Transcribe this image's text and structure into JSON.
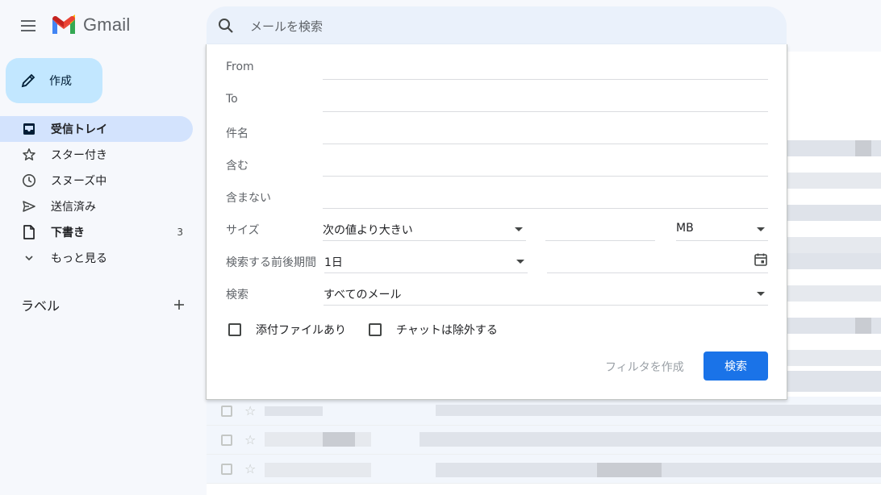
{
  "header": {
    "app_name": "Gmail",
    "search_placeholder": "メールを検索"
  },
  "compose": {
    "label": "作成"
  },
  "sidebar": {
    "items": [
      {
        "label": "受信トレイ",
        "icon": "inbox-icon",
        "active": true,
        "count": ""
      },
      {
        "label": "スター付き",
        "icon": "star-icon",
        "active": false,
        "count": ""
      },
      {
        "label": "スヌーズ中",
        "icon": "clock-icon",
        "active": false,
        "count": ""
      },
      {
        "label": "送信済み",
        "icon": "send-icon",
        "active": false,
        "count": ""
      },
      {
        "label": "下書き",
        "icon": "draft-icon",
        "active": false,
        "count": "3"
      },
      {
        "label": "もっと見る",
        "icon": "chevron-down-icon",
        "active": false,
        "count": ""
      }
    ],
    "labels_title": "ラベル"
  },
  "search_panel": {
    "from_label": "From",
    "to_label": "To",
    "subject_label": "件名",
    "has_words_label": "含む",
    "no_words_label": "含まない",
    "size_label": "サイズ",
    "size_operator": "次の値より大きい",
    "size_unit": "MB",
    "date_within_label": "検索する前後期間",
    "date_within_value": "1日",
    "search_in_label": "検索",
    "search_in_value": "すべてのメール",
    "has_attachment_label": "添付ファイルあり",
    "exclude_chats_label": "チャットは除外する",
    "create_filter_label": "フィルタを作成",
    "search_button_label": "検索"
  },
  "colors": {
    "background": "#f6f8fc",
    "compose_bg": "#c2e7ff",
    "active_nav_bg": "#d3e3fd",
    "search_bar_bg": "#eaf1fb",
    "primary_button": "#1a73e8"
  }
}
